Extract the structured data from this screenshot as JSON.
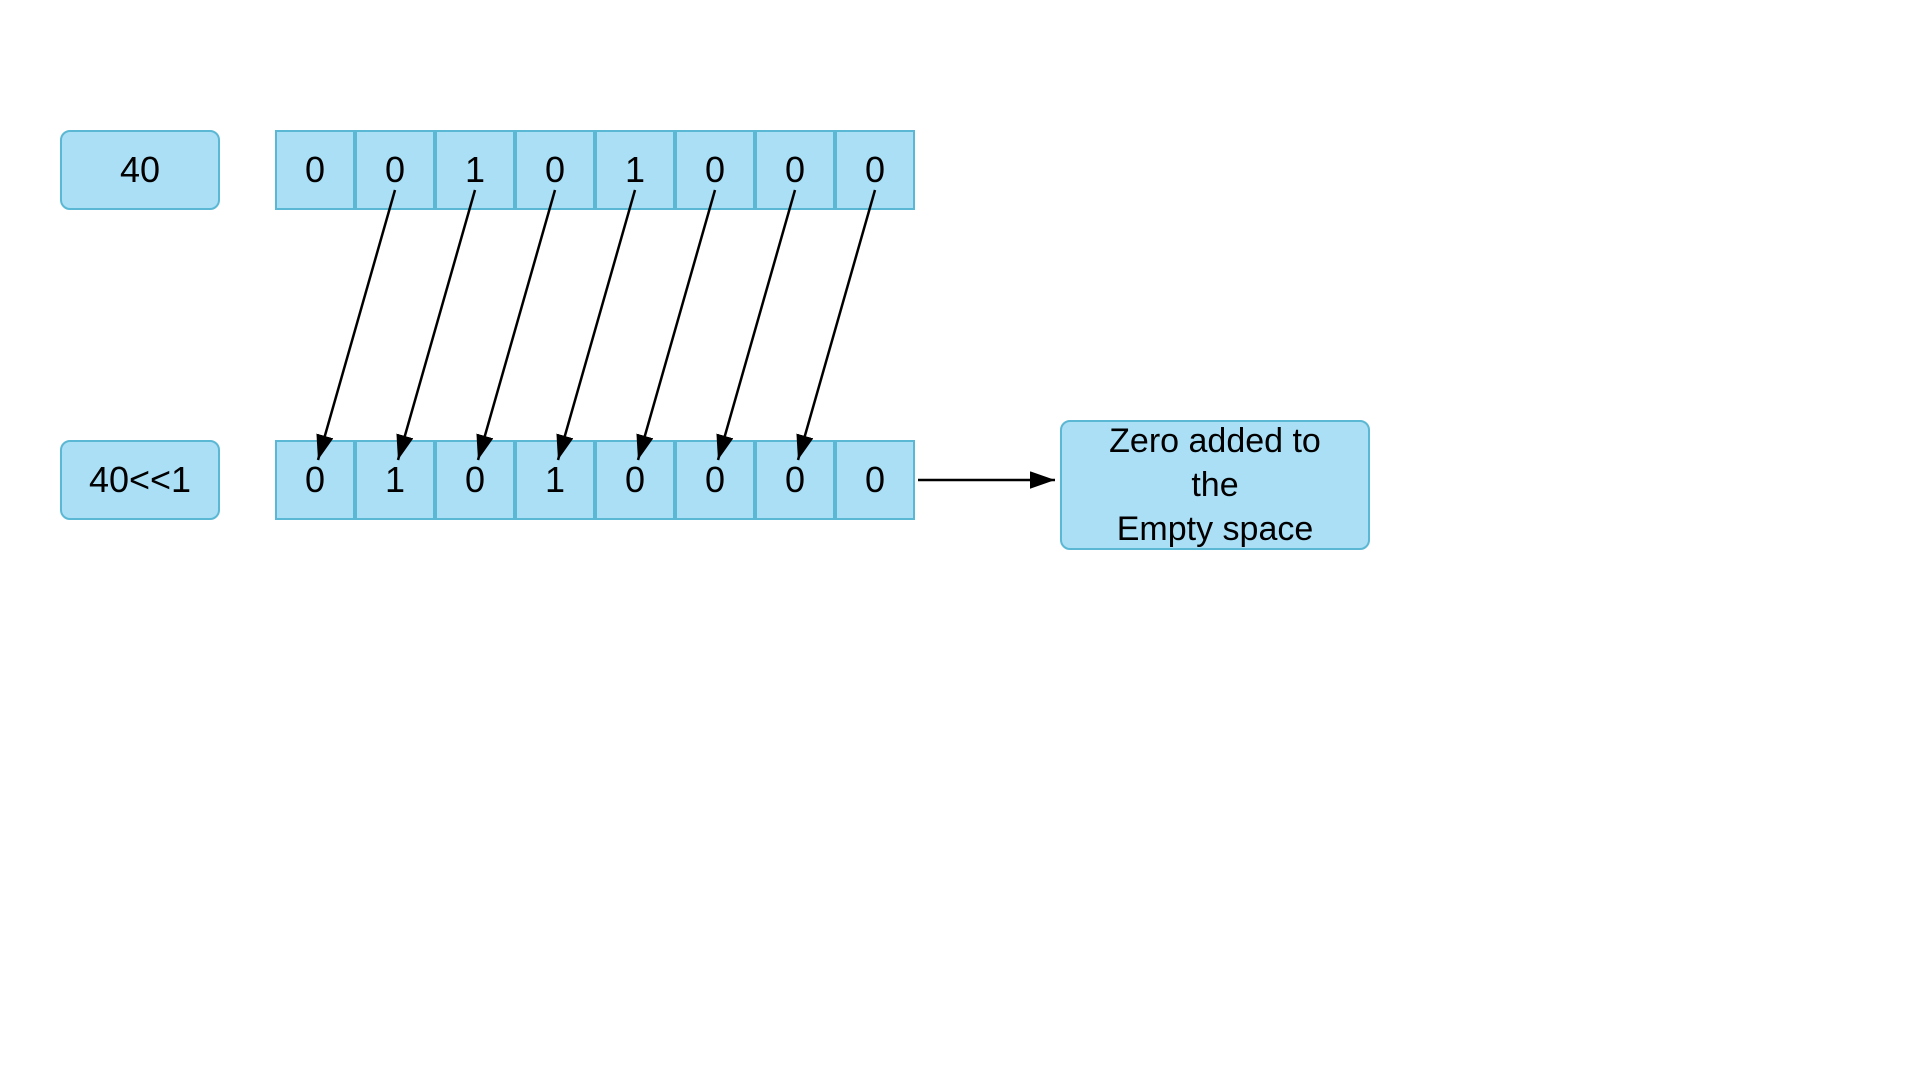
{
  "label_40": "40",
  "label_40shift": "40<<1",
  "top_bits": [
    "0",
    "0",
    "1",
    "0",
    "1",
    "0",
    "0",
    "0"
  ],
  "bottom_bits": [
    "0",
    "1",
    "0",
    "1",
    "0",
    "0",
    "0",
    "0"
  ],
  "annotation": "Zero added to the\nEmpty space",
  "colors": {
    "box_bg": "#aadff5",
    "box_border": "#5bb8d4",
    "arrow": "#000000"
  }
}
